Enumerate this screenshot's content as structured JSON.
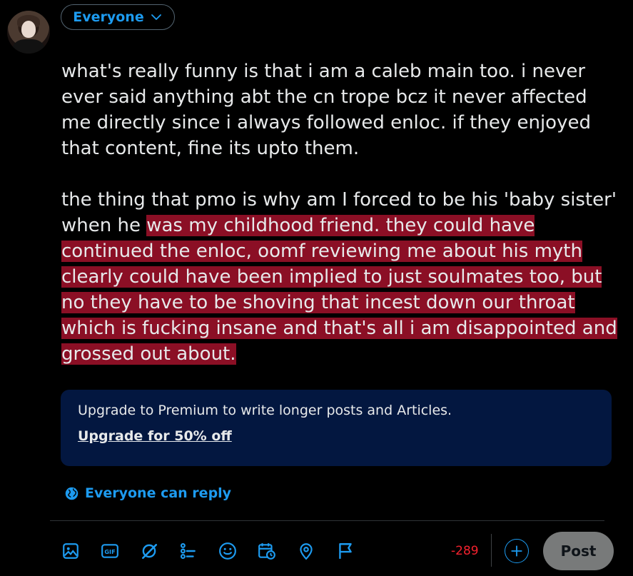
{
  "composer": {
    "audience_label": "Everyone",
    "post_text": {
      "para1": "what's really funny is that i am a caleb main too. i never ever said anything abt the cn trope bcz it never affected me directly since i always followed enloc. if they enjoyed that content, fine its upto them.",
      "para2_plain": "the thing that pmo is why am I forced to be his 'baby sister' when he ",
      "para2_highlight": "was my childhood friend. they could have continued the enloc, oomf reviewing me about his myth clearly could have been implied to just soulmates too, but no they have to be shoving that incest down our throat which is fucking insane and that's all i am disappointed and grossed out about."
    },
    "highlight_color": "#8b0f25"
  },
  "premium": {
    "message": "Upgrade to Premium to write longer posts and Articles.",
    "link": "Upgrade for 50% off"
  },
  "reply_setting": {
    "label": "Everyone can reply"
  },
  "toolbar": {
    "icons": [
      "image-icon",
      "gif-icon",
      "grok-icon",
      "poll-icon",
      "emoji-icon",
      "schedule-icon",
      "location-icon",
      "flag-icon"
    ],
    "char_counter": "-289",
    "post_label": "Post"
  },
  "colors": {
    "accent": "#1d9bf0",
    "premium_bg": "#031740",
    "counter": "#f4212e"
  }
}
